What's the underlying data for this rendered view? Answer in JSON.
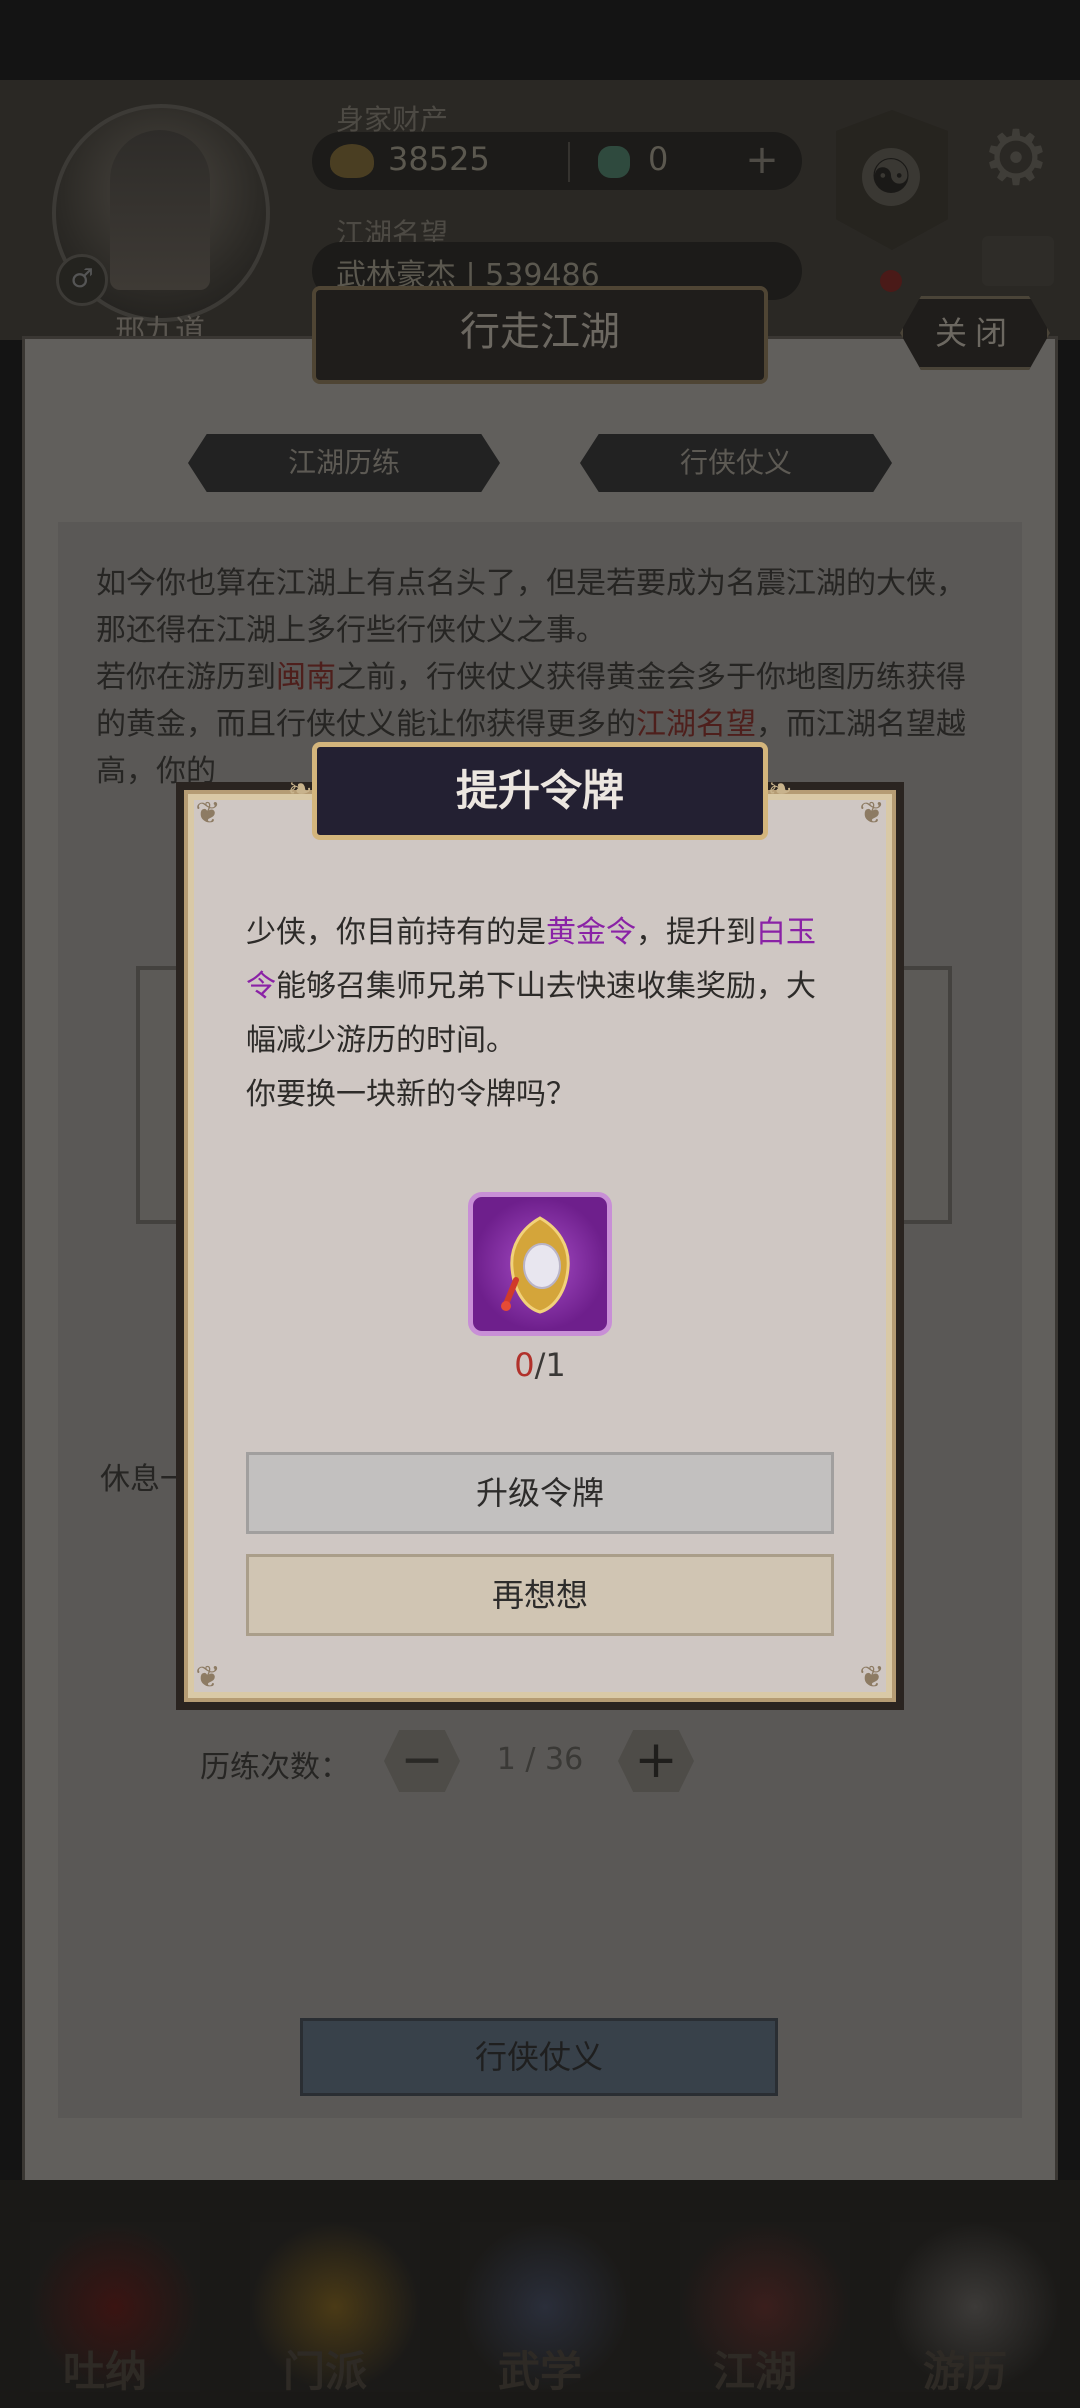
{
  "hud": {
    "player_name": "邢九道",
    "wealth_label": "身家财产",
    "gold_value": "38525",
    "jade_value": "0",
    "plus_symbol": "+",
    "fame_label": "江湖名望",
    "fame_text": "武林豪杰 | 539486"
  },
  "main": {
    "title": "行走江湖",
    "close_label": "关闭",
    "tabs": [
      {
        "label": "江湖历练"
      },
      {
        "label": "行侠仗义"
      }
    ],
    "paragraph1": "如今你也算在江湖上有点名头了，但是若要成为名震江湖的大侠，那还得在江湖上多行些行侠仗义之事。",
    "p2_a": "若你在游历到",
    "p2_place": "闽南",
    "p2_b": "之前，行侠仗义获得黄金会多于你地图历练获得的黄金，而且行侠仗义能让你获得更多的",
    "p2_fame": "江湖名望",
    "p2_c": "，而江湖名望越高，你的",
    "rest_label": "休息一",
    "count_label": "历练次数：",
    "count_value": "1 / 36",
    "minus_symbol": "−",
    "plus_symbol": "+",
    "action_label": "行侠仗义"
  },
  "modal": {
    "title": "提升令牌",
    "text_a": "少侠，你目前持有的是",
    "current_token": "黄金令",
    "text_b": "，提升到",
    "target_token": "白玉令",
    "text_c": "能够召集师兄弟下山去快速收集奖励，大幅减少游历的时间。",
    "question": "你要换一块新的令牌吗？",
    "item_have": "0",
    "item_need": "/1",
    "upgrade_label": "升级令牌",
    "think_label": "再想想"
  },
  "bottom_nav": [
    {
      "label": "吐纳"
    },
    {
      "label": "门派"
    },
    {
      "label": "武学"
    },
    {
      "label": "江湖"
    },
    {
      "label": "游历"
    }
  ]
}
